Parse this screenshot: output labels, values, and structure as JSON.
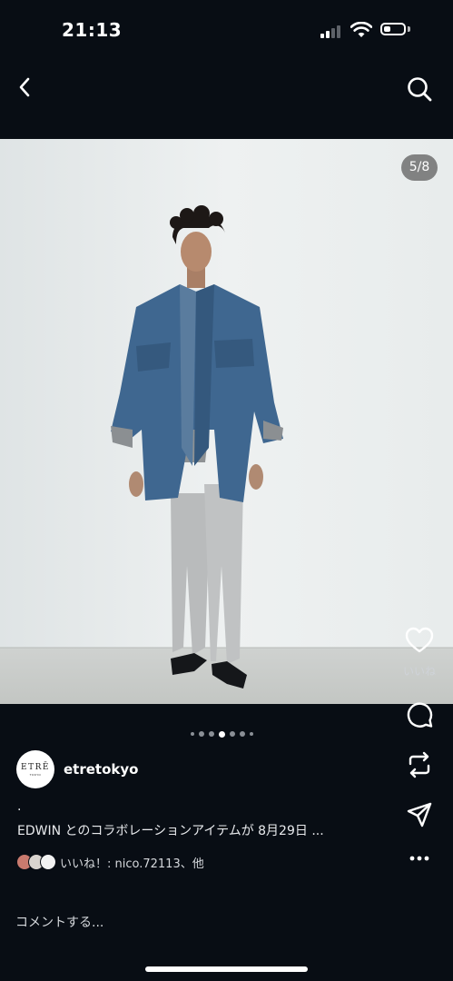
{
  "status": {
    "time": "21:13",
    "signal_icon": "cellular-signal-icon",
    "wifi_icon": "wifi-icon",
    "battery_icon": "battery-icon",
    "battery_level": 0.35
  },
  "nav": {
    "back_icon": "chevron-left-icon",
    "search_icon": "search-icon"
  },
  "post": {
    "image_index": "5/8",
    "carousel": {
      "total": 7,
      "active": 4
    },
    "like_count_label": "いいね",
    "author": {
      "avatar_logo": "ETRĒ",
      "avatar_sub": "TOKYO",
      "username": "etretokyo"
    },
    "caption_lead": ".",
    "caption": "EDWIN とのコラボレーションアイテムが 8月29日 ...",
    "liked_by": "いいね！: nico.72113、他",
    "comment_placeholder": "コメントする...",
    "actions": [
      "heart-icon",
      "comment-icon",
      "repost-icon",
      "share-icon",
      "more-icon"
    ]
  },
  "colors": {
    "background": "#080d14",
    "text": "#ffffff",
    "muted": "#d5d8dc",
    "dot_active": "#ffffff",
    "dot_inactive": "#8a8f96"
  }
}
